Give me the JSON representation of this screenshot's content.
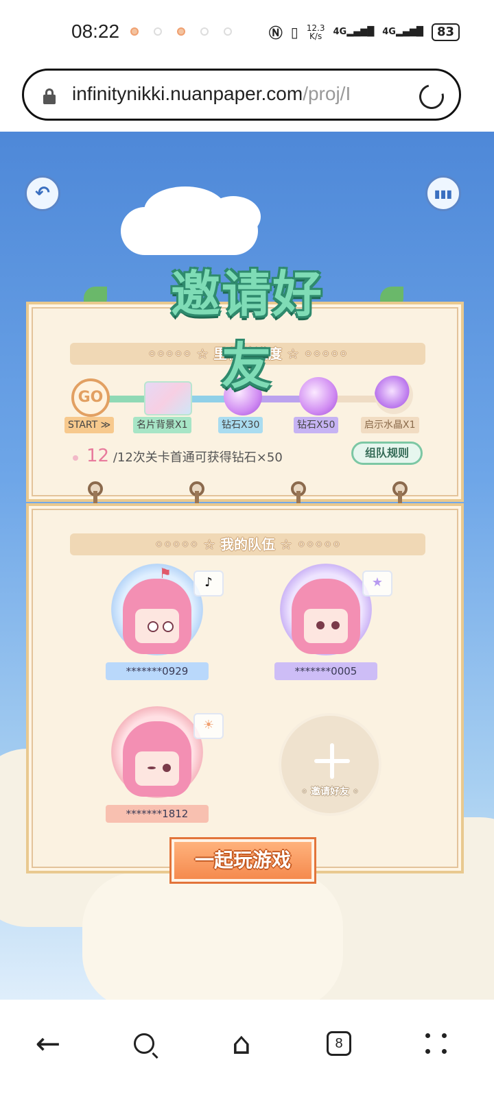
{
  "status": {
    "time": "08:22",
    "net_speed_value": "12.3",
    "net_speed_unit": "K/s",
    "signal1": "4G",
    "signal2": "4G",
    "battery": "83"
  },
  "browser": {
    "url_main": "infinitynikki.nuanpaper.com",
    "url_dim": "/proj/I"
  },
  "game": {
    "title": "邀请好友",
    "milestone_header": "◦◦◦◦◦ ☆ 里程碑进度 ☆ ◦◦◦◦◦",
    "go_label": "GO",
    "milestones": [
      {
        "label": "START ≫",
        "color": "#f7c98d"
      },
      {
        "label": "名片背景X1",
        "color": "#a7e5c6"
      },
      {
        "label": "钻石X30",
        "color": "#a9dcf0"
      },
      {
        "label": "钻石X50",
        "color": "#c6b3f3"
      },
      {
        "label": "启示水晶X1",
        "color": "#f1dcc2"
      }
    ],
    "progress_current": "12",
    "progress_text": "/12次关卡首通可获得钻石×50",
    "rules_button": "组队规则",
    "team_header": "◦◦◦◦◦ ☆ 我的队伍 ☆ ◦◦◦◦◦",
    "members": [
      {
        "name": "*******0929",
        "badge_icon": "music-note-icon"
      },
      {
        "name": "*******0005",
        "badge_icon": "star-icon"
      },
      {
        "name": "*******1812",
        "badge_icon": "sun-icon"
      }
    ],
    "invite_label": "◦ 邀请好友 ◦",
    "play_button": "一起玩游戏"
  },
  "nav": {
    "tab_count": "8"
  }
}
